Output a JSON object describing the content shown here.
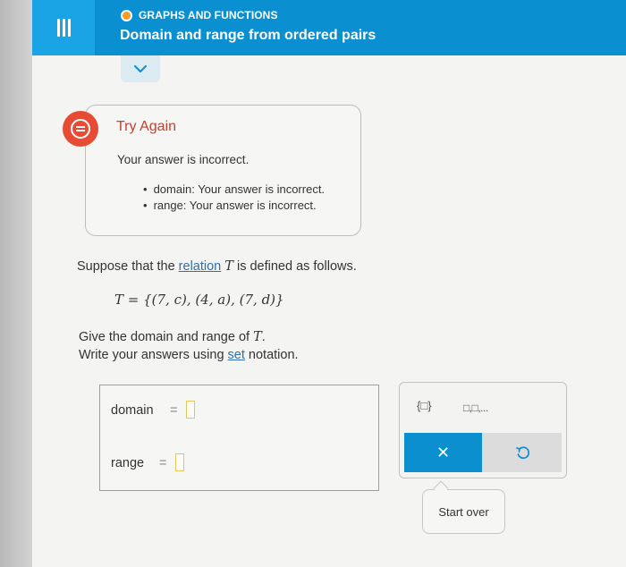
{
  "header": {
    "topic": "GRAPHS AND FUNCTIONS",
    "title": "Domain and range from ordered pairs"
  },
  "feedback": {
    "title": "Try Again",
    "message": "Your answer is incorrect.",
    "items": [
      "domain: Your answer is incorrect.",
      "range: Your answer is incorrect."
    ]
  },
  "problem": {
    "line1_pre": "Suppose that the ",
    "relation_link": "relation",
    "line1_var": "T",
    "line1_post": " is defined as follows.",
    "set_definition": "T = {(7, c), (4, a), (7, d)}",
    "line2_pre": "Give the domain and range of ",
    "line2_var": "T",
    "line2_post": ".",
    "line3_pre": "Write your answers using ",
    "set_link": "set",
    "line3_post": " notation."
  },
  "answer": {
    "domain_label": "domain",
    "range_label": "range",
    "equals": "="
  },
  "tools": {
    "set_button": "{□}",
    "list_button": "□,□,...",
    "clear_symbol": "✕",
    "start_over": "Start over"
  },
  "colors": {
    "header_blue": "#0a8fd1",
    "feedback_red": "#e84b33",
    "link_blue": "#2f6fb0"
  }
}
